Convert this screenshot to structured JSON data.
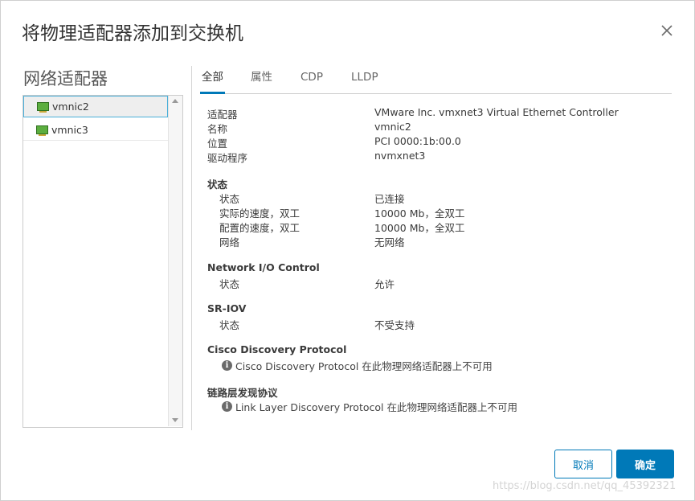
{
  "dialog": {
    "title": "将物理适配器添加到交换机",
    "cancel_label": "取消",
    "ok_label": "确定"
  },
  "left_panel": {
    "title": "网络适配器",
    "adapters": [
      {
        "label": "vmnic2",
        "selected": true
      },
      {
        "label": "vmnic3",
        "selected": false
      }
    ]
  },
  "tabs": [
    "全部",
    "属性",
    "CDP",
    "LLDP"
  ],
  "active_tab": "全部",
  "details": {
    "general": [
      {
        "label": "适配器",
        "value": "VMware Inc. vmxnet3 Virtual Ethernet Controller"
      },
      {
        "label": "名称",
        "value": "vmnic2"
      },
      {
        "label": "位置",
        "value": "PCI 0000:1b:00.0"
      },
      {
        "label": "驱动程序",
        "value": "nvmxnet3"
      }
    ],
    "status_section": {
      "title": "状态",
      "rows": [
        {
          "label": "状态",
          "value": "已连接"
        },
        {
          "label": "实际的速度，双工",
          "value": "10000 Mb，全双工"
        },
        {
          "label": "配置的速度，双工",
          "value": "10000 Mb，全双工"
        },
        {
          "label": "网络",
          "value": "无网络"
        }
      ]
    },
    "nioc_section": {
      "title": "Network I/O Control",
      "rows": [
        {
          "label": "状态",
          "value": "允许"
        }
      ]
    },
    "sriov_section": {
      "title": "SR-IOV",
      "rows": [
        {
          "label": "状态",
          "value": "不受支持"
        }
      ]
    },
    "cdp_section": {
      "title": "Cisco Discovery Protocol",
      "message": "Cisco Discovery Protocol 在此物理网络适配器上不可用"
    },
    "lldp_section": {
      "title": "链路层发现协议",
      "message": "Link Layer Discovery Protocol 在此物理网络适配器上不可用"
    }
  },
  "watermark": "https://blog.csdn.net/qq_45392321",
  "colors": {
    "accent": "#0079b8",
    "selection_border": "#49afd9"
  }
}
